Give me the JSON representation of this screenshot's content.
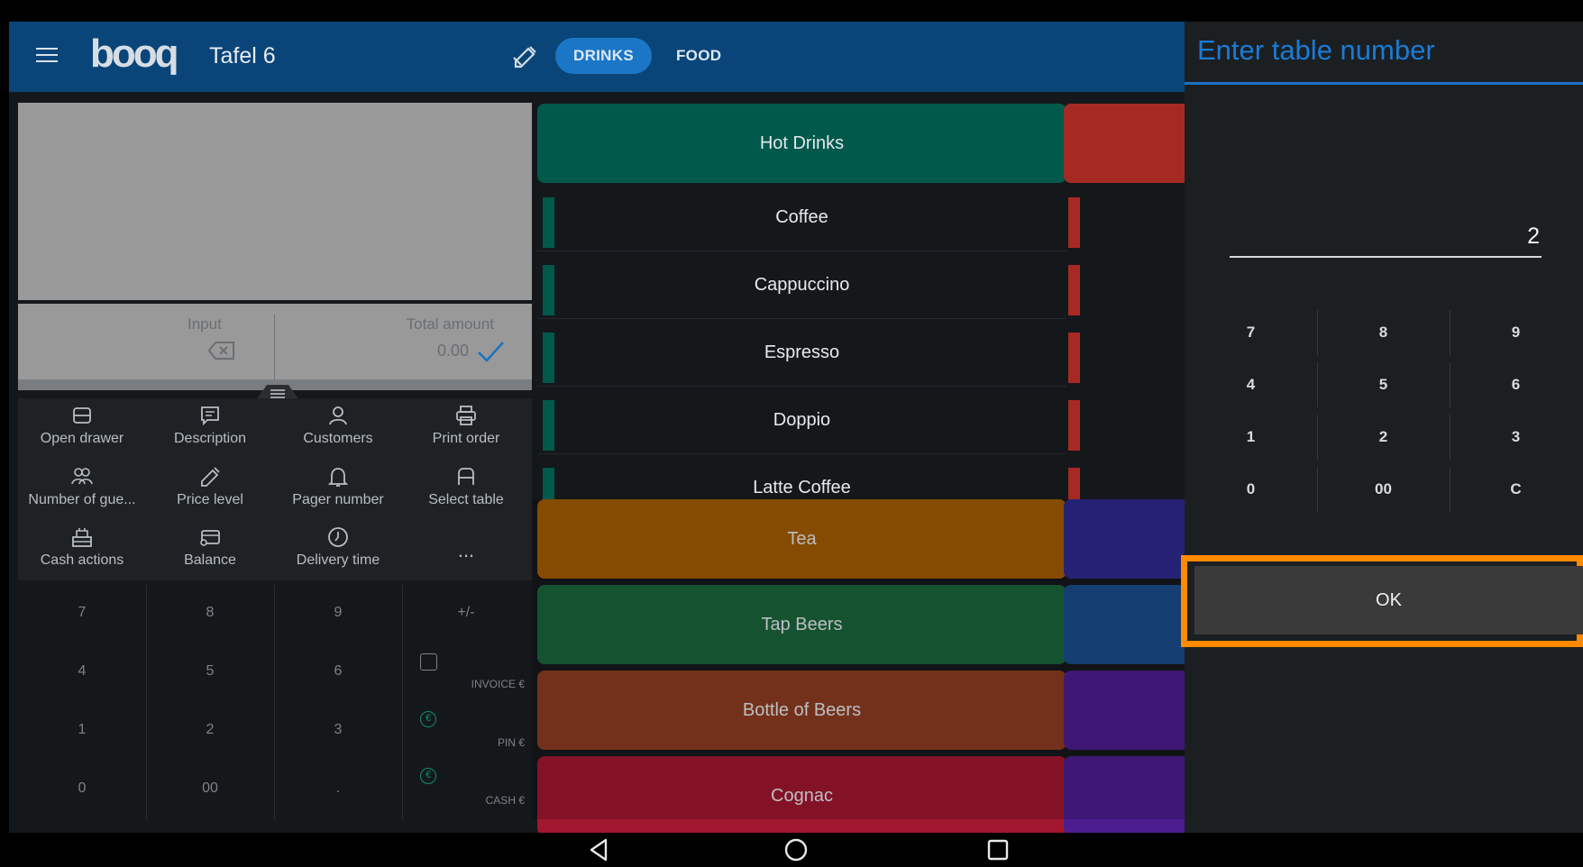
{
  "header": {
    "logo": "booq",
    "table_title": "Tafel 6",
    "tabs": [
      {
        "label": "DRINKS",
        "active": true
      },
      {
        "label": "FOOD",
        "active": false
      }
    ]
  },
  "amount": {
    "input_label": "Input",
    "total_label": "Total amount",
    "total_value": "0.00"
  },
  "actions": [
    {
      "label": "Open drawer",
      "icon": "drawer-icon"
    },
    {
      "label": "Description",
      "icon": "note-icon"
    },
    {
      "label": "Customers",
      "icon": "person-icon"
    },
    {
      "label": "Print order",
      "icon": "printer-icon"
    },
    {
      "label": "Number of gue...",
      "icon": "people-icon"
    },
    {
      "label": "Price level",
      "icon": "tag-icon"
    },
    {
      "label": "Pager number",
      "icon": "bell-icon"
    },
    {
      "label": "Select table",
      "icon": "chair-icon"
    },
    {
      "label": "Cash actions",
      "icon": "register-icon"
    },
    {
      "label": "Balance",
      "icon": "wallet-icon"
    },
    {
      "label": "Delivery time",
      "icon": "clock-icon"
    },
    {
      "label": "...",
      "icon": "more-icon"
    }
  ],
  "left_numpad": {
    "keys": [
      "7",
      "8",
      "9",
      "+/-",
      "4",
      "5",
      "6",
      "1",
      "2",
      "3",
      "0",
      "00",
      "."
    ],
    "payments": [
      "INVOICE €",
      "PIN €",
      "CASH €"
    ]
  },
  "categories": [
    {
      "label": "Hot Drinks",
      "color": "#00594b"
    },
    {
      "label": "Tea",
      "color": "#a35c00"
    },
    {
      "label": "Tap Beers",
      "color": "#1a653b"
    },
    {
      "label": "Bottle of Beers",
      "color": "#8d3c22"
    },
    {
      "label": "Cognac",
      "color": "#a1172f"
    }
  ],
  "products": [
    "Coffee",
    "Cappuccino",
    "Espresso",
    "Doppio",
    "Latte Coffee"
  ],
  "side_colors": [
    "#a62a23",
    "#2e2a90",
    "#1a4c8c",
    "#4c1d8e",
    "#4c1d8e"
  ],
  "dialog": {
    "title": "Enter table number",
    "value": "2",
    "keys": [
      "7",
      "8",
      "9",
      "4",
      "5",
      "6",
      "1",
      "2",
      "3",
      "0",
      "00",
      "C"
    ],
    "ok_label": "OK",
    "accent": "#1a7bd4",
    "highlight": "#ff8a00"
  }
}
